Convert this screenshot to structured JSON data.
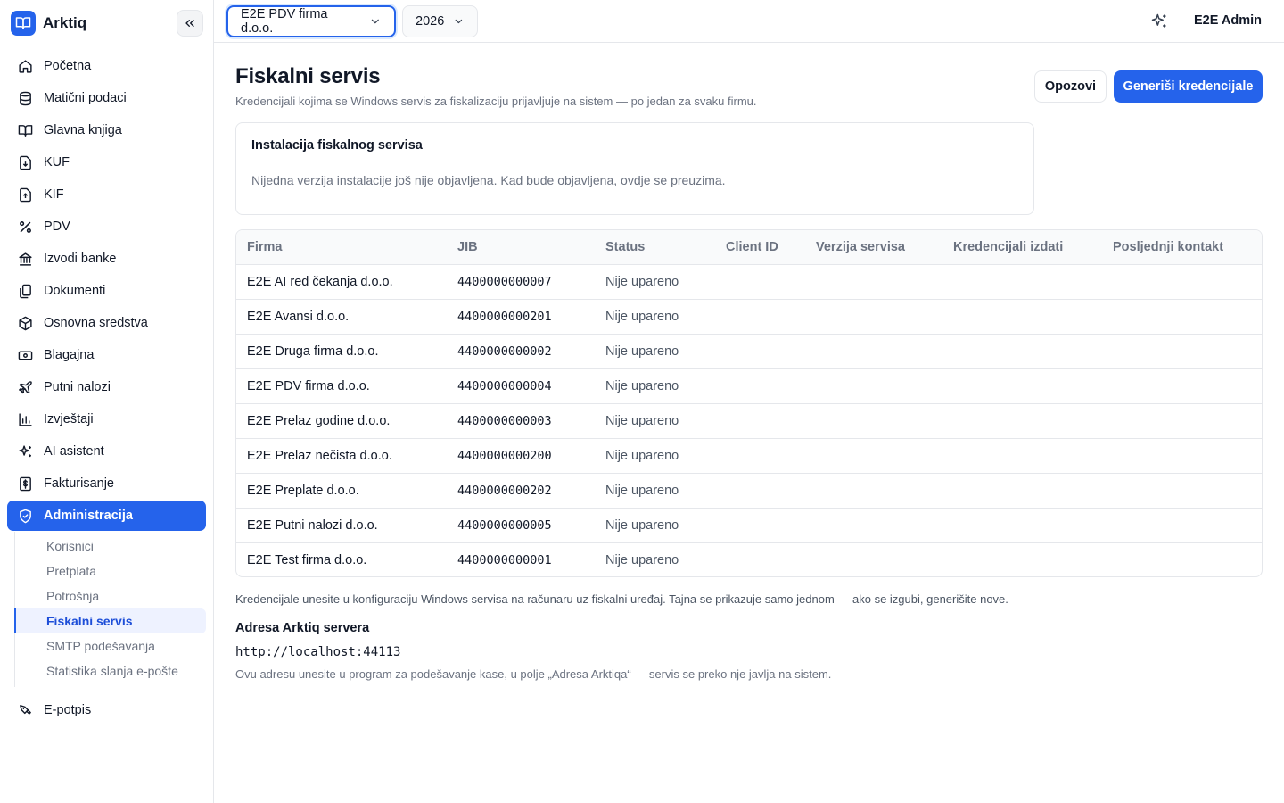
{
  "app": {
    "name": "Arktiq"
  },
  "sidebar": {
    "items": [
      {
        "label": "Početna",
        "icon": "home-icon"
      },
      {
        "label": "Matični podaci",
        "icon": "database-icon"
      },
      {
        "label": "Glavna knjiga",
        "icon": "book-icon"
      },
      {
        "label": "KUF",
        "icon": "file-in-icon"
      },
      {
        "label": "KIF",
        "icon": "file-out-icon"
      },
      {
        "label": "PDV",
        "icon": "percent-icon"
      },
      {
        "label": "Izvodi banke",
        "icon": "bank-icon"
      },
      {
        "label": "Dokumenti",
        "icon": "documents-icon"
      },
      {
        "label": "Osnovna sredstva",
        "icon": "box-icon"
      },
      {
        "label": "Blagajna",
        "icon": "cash-icon"
      },
      {
        "label": "Putni nalozi",
        "icon": "plane-icon"
      },
      {
        "label": "Izvještaji",
        "icon": "chart-icon"
      },
      {
        "label": "AI asistent",
        "icon": "sparkles-icon"
      },
      {
        "label": "Fakturisanje",
        "icon": "invoice-icon"
      },
      {
        "label": "Administracija",
        "icon": "shield-icon"
      }
    ],
    "sub_items": [
      {
        "label": "Korisnici"
      },
      {
        "label": "Pretplata"
      },
      {
        "label": "Potrošnja"
      },
      {
        "label": "Fiskalni servis"
      },
      {
        "label": "SMTP podešavanja"
      },
      {
        "label": "Statistika slanja e-pošte"
      }
    ],
    "last_item": {
      "label": "E-potpis",
      "icon": "signature-icon"
    },
    "active_item": "Administracija",
    "active_sub_item": "Fiskalni servis"
  },
  "topbar": {
    "firm_select": "E2E PDV firma d.o.o.",
    "year_select": "2026",
    "user": "E2E Admin"
  },
  "page": {
    "title": "Fiskalni servis",
    "subtitle": "Kredencijali kojima se Windows servis za fiskalizaciju prijavljuje na sistem — po jedan za svaku firmu.",
    "revoke_button": "Opozovi",
    "generate_button": "Generiši kredencijale"
  },
  "install": {
    "title": "Instalacija fiskalnog servisa",
    "text": "Nijedna verzija instalacije još nije objavljena. Kad bude objavljena, ovdje se preuzima."
  },
  "table": {
    "columns": [
      "Firma",
      "JIB",
      "Status",
      "Client ID",
      "Verzija servisa",
      "Kredencijali izdati",
      "Posljednji kontakt"
    ],
    "rows": [
      {
        "firma": "E2E AI red čekanja d.o.o.",
        "jib": "4400000000007",
        "status": "Nije upareno"
      },
      {
        "firma": "E2E Avansi d.o.o.",
        "jib": "4400000000201",
        "status": "Nije upareno"
      },
      {
        "firma": "E2E Druga firma d.o.o.",
        "jib": "4400000000002",
        "status": "Nije upareno"
      },
      {
        "firma": "E2E PDV firma d.o.o.",
        "jib": "4400000000004",
        "status": "Nije upareno"
      },
      {
        "firma": "E2E Prelaz godine d.o.o.",
        "jib": "4400000000003",
        "status": "Nije upareno"
      },
      {
        "firma": "E2E Prelaz nečista d.o.o.",
        "jib": "4400000000200",
        "status": "Nije upareno"
      },
      {
        "firma": "E2E Preplate d.o.o.",
        "jib": "4400000000202",
        "status": "Nije upareno"
      },
      {
        "firma": "E2E Putni nalozi d.o.o.",
        "jib": "4400000000005",
        "status": "Nije upareno"
      },
      {
        "firma": "E2E Test firma d.o.o.",
        "jib": "4400000000001",
        "status": "Nije upareno"
      }
    ]
  },
  "footer": {
    "note": "Kredencijale unesite u konfiguraciju Windows servisa na računaru uz fiskalni uređaj. Tajna se prikazuje samo jednom — ako se izgubi, generišite nove.",
    "address_label": "Adresa Arktiq servera",
    "address_value": "http://localhost:44113",
    "address_help": "Ovu adresu unesite u program za podešavanje kase, u polje „Adresa Arktiqa“ — servis se preko nje javlja na sistem."
  },
  "colors": {
    "accent": "#2563eb",
    "muted_text": "#6b7280",
    "border": "#e5e7eb"
  }
}
